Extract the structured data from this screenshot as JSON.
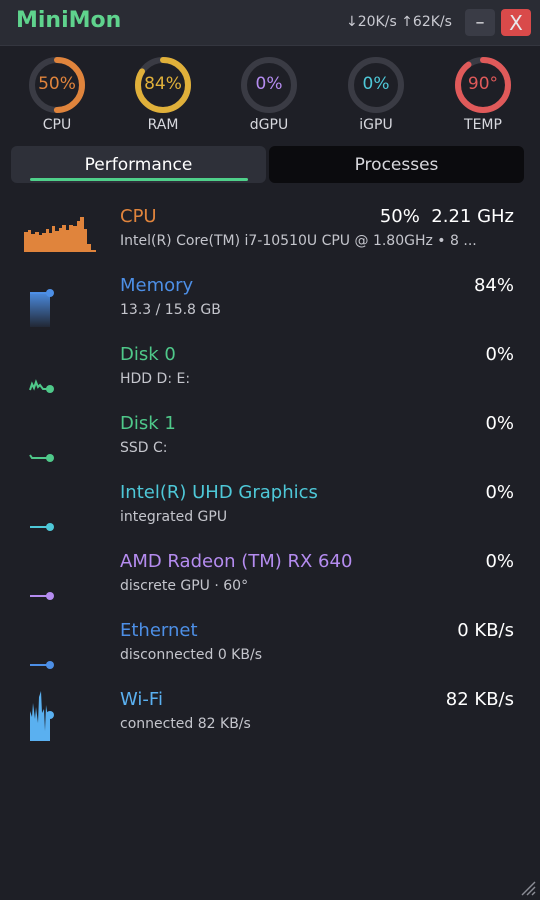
{
  "window": {
    "title": "MiniMon",
    "net_speed": "↓20K/s ↑62K/s",
    "minimize_label": "–",
    "close_label": "X"
  },
  "gauges": [
    {
      "label": "CPU",
      "value_text": "50%",
      "value": 50,
      "color": "#e0843c"
    },
    {
      "label": "RAM",
      "value_text": "84%",
      "value": 84,
      "color": "#e0b03a"
    },
    {
      "label": "dGPU",
      "value_text": "0%",
      "value": 0,
      "color": "#b58cf0"
    },
    {
      "label": "iGPU",
      "value_text": "0%",
      "value": 0,
      "color": "#4ec8d8"
    },
    {
      "label": "TEMP",
      "value_text": "90°",
      "value": 90,
      "color": "#e05a5a"
    }
  ],
  "tabs": [
    {
      "label": "Performance",
      "active": true
    },
    {
      "label": "Processes",
      "active": false
    }
  ],
  "rows": [
    {
      "name": "CPU",
      "sub": "Intel(R) Core(TM) i7-10510U CPU @ 1.80GHz  •  8 ...",
      "value": "50%  2.21 GHz",
      "color": "#e0843c",
      "icon": "cpu-activity-icon"
    },
    {
      "name": "Memory",
      "sub": "13.3 / 15.8 GB",
      "value": "84%",
      "color": "#4d8fe6",
      "icon": "memory-activity-icon"
    },
    {
      "name": "Disk 0",
      "sub": "HDD  D: E:",
      "value": "0%",
      "color": "#4fc98a",
      "icon": "disk-activity-icon"
    },
    {
      "name": "Disk 1",
      "sub": "SSD  C:",
      "value": "0%",
      "color": "#4fc98a",
      "icon": "disk-activity-icon"
    },
    {
      "name": "Intel(R) UHD Graphics",
      "sub": "integrated GPU",
      "value": "0%",
      "color": "#4ec8d8",
      "icon": "gpu-activity-icon"
    },
    {
      "name": "AMD Radeon (TM) RX 640",
      "sub": "discrete GPU  ·  60°",
      "value": "0%",
      "color": "#b58cf0",
      "icon": "gpu-activity-icon"
    },
    {
      "name": "Ethernet",
      "sub": "disconnected   0 KB/s",
      "value": "0 KB/s",
      "color": "#4d8fe6",
      "icon": "network-activity-icon"
    },
    {
      "name": "Wi-Fi",
      "sub": "connected   82 KB/s",
      "value": "82 KB/s",
      "color": "#5ab0f0",
      "icon": "wifi-activity-icon"
    }
  ]
}
